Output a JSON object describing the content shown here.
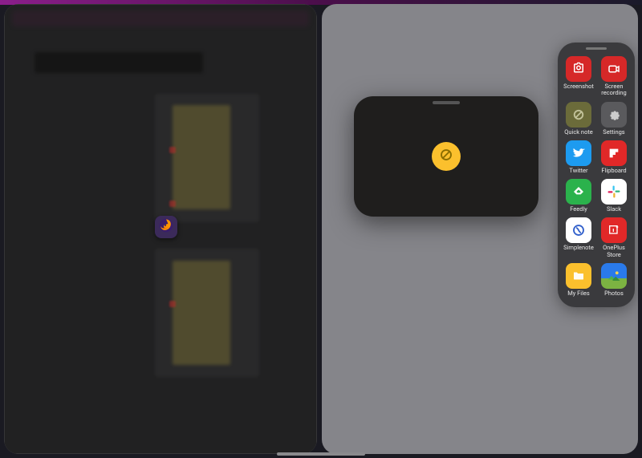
{
  "splitView": {
    "left": {
      "appBadge": "firefox-icon"
    },
    "right": {
      "floatingWindow": {
        "centerIcon": "block-icon"
      },
      "toolPanel": {
        "items": [
          {
            "id": "screenshot",
            "label": "Screenshot",
            "icon": "screenshot-icon",
            "color": "#d62828"
          },
          {
            "id": "screen-recording",
            "label": "Screen\nrecording",
            "icon": "record-icon",
            "color": "#d62828"
          },
          {
            "id": "quick-note",
            "label": "Quick note",
            "icon": "block-icon",
            "color": "#6b6b3a"
          },
          {
            "id": "settings",
            "label": "Settings",
            "icon": "gear-icon",
            "color": "#5a5a5d"
          },
          {
            "id": "twitter",
            "label": "Twitter",
            "icon": "twitter-icon",
            "color": "#1d9bf0"
          },
          {
            "id": "flipboard",
            "label": "Flipboard",
            "icon": "flipboard-icon",
            "color": "#e12828"
          },
          {
            "id": "feedly",
            "label": "Feedly",
            "icon": "feedly-icon",
            "color": "#2bb24c"
          },
          {
            "id": "slack",
            "label": "Slack",
            "icon": "slack-icon",
            "color": "#ffffff"
          },
          {
            "id": "simplenote",
            "label": "Simplenote",
            "icon": "simplenote-icon",
            "color": "#ffffff"
          },
          {
            "id": "oneplus-store",
            "label": "OnePlus\nStore",
            "icon": "oneplus-icon",
            "color": "#e12828"
          },
          {
            "id": "my-files",
            "label": "My Files",
            "icon": "folder-icon",
            "color": "#fbc02d"
          },
          {
            "id": "photos",
            "label": "Photos",
            "icon": "photos-icon",
            "color": "#2a7aea"
          }
        ]
      }
    }
  }
}
